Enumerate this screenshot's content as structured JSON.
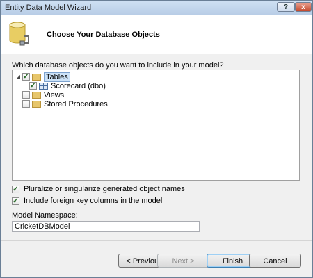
{
  "window": {
    "title": "Entity Data Model Wizard",
    "help_glyph": "?",
    "close_glyph": "x"
  },
  "header": {
    "page_title": "Choose Your Database Objects",
    "icon": "database-icon"
  },
  "question": "Which database objects do you want to include in your model?",
  "tree": {
    "tables": {
      "label": "Tables",
      "checked": true,
      "expanded": true
    },
    "scorecard": {
      "label": "Scorecard (dbo)",
      "checked": true
    },
    "views": {
      "label": "Views",
      "checked": false
    },
    "stored_procedures": {
      "label": "Stored Procedures",
      "checked": false
    }
  },
  "options": {
    "pluralize": {
      "label": "Pluralize or singularize generated object names",
      "checked": true
    },
    "foreign_keys": {
      "label": "Include foreign key columns in the model",
      "checked": true
    }
  },
  "namespace": {
    "label": "Model Namespace:",
    "value": "CricketDBModel"
  },
  "buttons": {
    "previous": "< Previous",
    "next": "Next >",
    "finish": "Finish",
    "cancel": "Cancel"
  }
}
